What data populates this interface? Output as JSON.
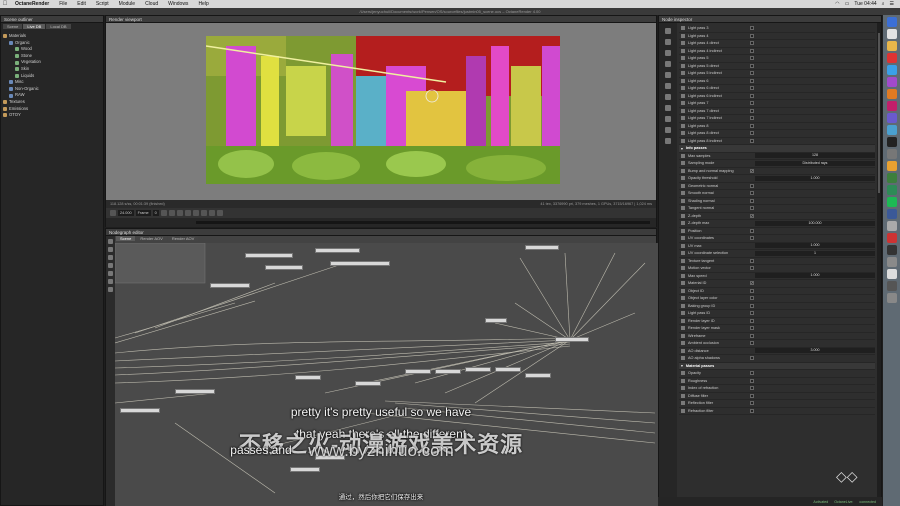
{
  "menubar": {
    "app": "OctaneRender",
    "items": [
      "File",
      "Edit",
      "Script",
      "Module",
      "Cloud",
      "Windows",
      "Help"
    ],
    "clock": "Tue 04:44"
  },
  "window_title": "/Users/jenyuchuii/Documents/work/Pensen/OS/sourcefiles/justmin05_scene.ocs – OctaneRender 4.00",
  "outliner": {
    "title": "Scene outliner",
    "tabs": [
      "Scene",
      "Live DB",
      "Local DB"
    ],
    "tree": [
      {
        "label": "Materials",
        "depth": 0
      },
      {
        "label": "Organic",
        "depth": 1
      },
      {
        "label": "Wood",
        "depth": 2
      },
      {
        "label": "Stone",
        "depth": 2
      },
      {
        "label": "Vegetation",
        "depth": 2
      },
      {
        "label": "Skin",
        "depth": 2
      },
      {
        "label": "Liquids",
        "depth": 2
      },
      {
        "label": "Misc",
        "depth": 1
      },
      {
        "label": "Non-Organic",
        "depth": 1
      },
      {
        "label": "RAW",
        "depth": 1
      },
      {
        "label": "Textures",
        "depth": 0
      },
      {
        "label": "Emissions",
        "depth": 0
      },
      {
        "label": "OTOY",
        "depth": 0
      }
    ]
  },
  "viewport": {
    "title": "Render viewport",
    "status_left": "118.128 s/ss, 00:01:39 (finished)",
    "status_right": "41 tex, 3376990 pri, 379 meshes, 1 GPUs, 3715/16967 | 1,024 ms",
    "fps": "24.000",
    "frame_label": "Frame",
    "frame": "0"
  },
  "nodegraph": {
    "title": "Nodegraph editor",
    "tabs": [
      "Scene",
      "Render AOV",
      "Render AOV"
    ]
  },
  "subtitles": {
    "line1": "pretty it's pretty useful so we have",
    "line2": "that yeah there's all the different",
    "line3": "passes and",
    "chinese": "通过，然后你把它们保存出来"
  },
  "watermark": {
    "line1": "不移之火-动漫游戏美术资源",
    "line2": "www.byzhihuo.com"
  },
  "inspector": {
    "title": "Node inspector",
    "rows": [
      {
        "label": "Light pass 3",
        "type": "check"
      },
      {
        "label": "Light pass 4",
        "type": "check"
      },
      {
        "label": "Light pass 4 direct",
        "type": "check"
      },
      {
        "label": "Light pass 4 indirect",
        "type": "check"
      },
      {
        "label": "Light pass 5",
        "type": "check"
      },
      {
        "label": "Light pass 5 direct",
        "type": "check"
      },
      {
        "label": "Light pass 5 indirect",
        "type": "check"
      },
      {
        "label": "Light pass 6",
        "type": "check"
      },
      {
        "label": "Light pass 6 direct",
        "type": "check"
      },
      {
        "label": "Light pass 6 indirect",
        "type": "check"
      },
      {
        "label": "Light pass 7",
        "type": "check"
      },
      {
        "label": "Light pass 7 direct",
        "type": "check"
      },
      {
        "label": "Light pass 7 indirect",
        "type": "check"
      },
      {
        "label": "Light pass 8",
        "type": "check"
      },
      {
        "label": "Light pass 8 direct",
        "type": "check"
      },
      {
        "label": "Light pass 8 indirect",
        "type": "check"
      },
      {
        "label": "Info passes",
        "type": "section"
      },
      {
        "label": "Max samples",
        "type": "value",
        "value": "128"
      },
      {
        "label": "Sampling mode",
        "type": "value",
        "value": "Distributed rays"
      },
      {
        "label": "Bump and normal mapping",
        "type": "check",
        "checked": "✔"
      },
      {
        "label": "Opacity threshold",
        "type": "value",
        "value": "1.000"
      },
      {
        "label": "Geometric normal",
        "type": "check"
      },
      {
        "label": "Smooth normal",
        "type": "check"
      },
      {
        "label": "Shading normal",
        "type": "check"
      },
      {
        "label": "Tangent normal",
        "type": "check"
      },
      {
        "label": "Z-depth",
        "type": "check",
        "checked": "✔"
      },
      {
        "label": "Z-depth max",
        "type": "value",
        "value": "100.000"
      },
      {
        "label": "Position",
        "type": "check"
      },
      {
        "label": "UV coordinates",
        "type": "check"
      },
      {
        "label": "UV max",
        "type": "value",
        "value": "1.000"
      },
      {
        "label": "UV coordinate selection",
        "type": "value",
        "value": "1"
      },
      {
        "label": "Texture tangent",
        "type": "check"
      },
      {
        "label": "Motion vector",
        "type": "check"
      },
      {
        "label": "Max speed",
        "type": "value",
        "value": "1.000"
      },
      {
        "label": "Material ID",
        "type": "check",
        "checked": "✔"
      },
      {
        "label": "Object ID",
        "type": "check"
      },
      {
        "label": "Object layer color",
        "type": "check"
      },
      {
        "label": "Baking group ID",
        "type": "check"
      },
      {
        "label": "Light pass ID",
        "type": "check"
      },
      {
        "label": "Render layer ID",
        "type": "check"
      },
      {
        "label": "Render layer mask",
        "type": "check"
      },
      {
        "label": "Wireframe",
        "type": "check"
      },
      {
        "label": "Ambient occlusion",
        "type": "check"
      },
      {
        "label": "AO distance",
        "type": "value",
        "value": "3.000"
      },
      {
        "label": "AO alpha shadows",
        "type": "check"
      },
      {
        "label": "Material passes",
        "type": "section"
      },
      {
        "label": "Opacity",
        "type": "check"
      },
      {
        "label": "Roughness",
        "type": "check"
      },
      {
        "label": "Index of refraction",
        "type": "check"
      },
      {
        "label": "Diffuse filter",
        "type": "check"
      },
      {
        "label": "Reflection filter",
        "type": "check"
      },
      {
        "label": "Refraction filter",
        "type": "check"
      }
    ]
  },
  "statusbar": {
    "activated": "Activated",
    "octanelive": "OctaneLive:",
    "connected": "connected"
  },
  "colors": {
    "panel": "#2b2b2b",
    "graph": "#4a4a4a",
    "accent": "#7fbf7f"
  }
}
